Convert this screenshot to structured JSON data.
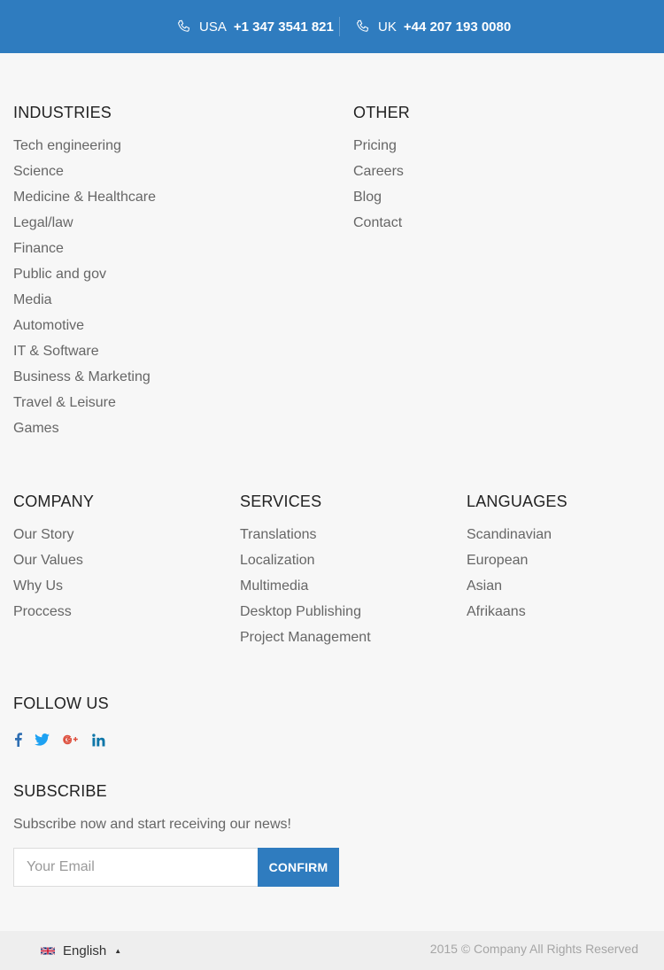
{
  "topbar": {
    "usa": {
      "country": "USA",
      "number": "+1 347 3541 821"
    },
    "uk": {
      "country": "UK",
      "number": "+44 207 193 0080"
    }
  },
  "industries": {
    "title": "INDUSTRIES",
    "items": [
      "Tech engineering",
      "Science",
      "Medicine & Healthcare",
      "Legal/law",
      "Finance",
      "Public and gov",
      "Media",
      "Automotive",
      "IT & Software",
      "Business & Marketing",
      "Travel & Leisure",
      "Games"
    ]
  },
  "other": {
    "title": "OTHER",
    "items": [
      "Pricing",
      "Careers",
      "Blog",
      "Contact"
    ]
  },
  "company": {
    "title": "COMPANY",
    "items": [
      "Our Story",
      "Our Values",
      "Why Us",
      "Proccess"
    ]
  },
  "services": {
    "title": "SERVICES",
    "items": [
      "Translations",
      "Localization",
      "Multimedia",
      "Desktop Publishing",
      "Project Management"
    ]
  },
  "languages": {
    "title": "LANGUAGES",
    "items": [
      "Scandinavian",
      "European",
      "Asian",
      "Afrikaans"
    ]
  },
  "follow": {
    "title": "FOLLOW US",
    "icons": [
      "facebook-icon",
      "twitter-icon",
      "google-plus-icon",
      "linkedin-icon"
    ]
  },
  "subscribe": {
    "title": "SUBSCRIBE",
    "text": "Subscribe now and start receiving our news!",
    "placeholder": "Your Email",
    "value": "",
    "button": "CONFIRM"
  },
  "footer": {
    "language": "English",
    "copyright": "2015 © Company All Rights Reserved"
  },
  "colors": {
    "accent": "#2f7cbf",
    "facebook": "#3b5998",
    "twitter": "#1da1f2",
    "google_plus": "#dd4b39",
    "linkedin": "#0e76a8"
  }
}
